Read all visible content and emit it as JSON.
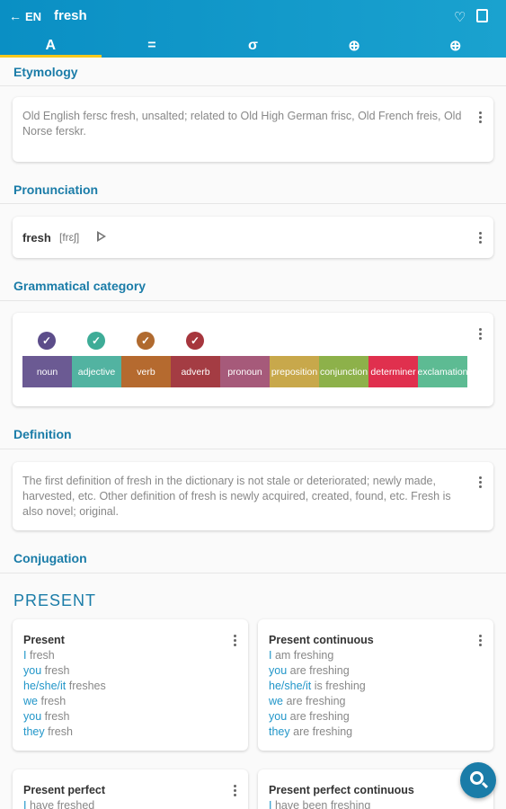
{
  "header": {
    "back_icon": "←",
    "language": "EN",
    "word": "fresh",
    "heart_icon": "♡"
  },
  "tabs": [
    {
      "label": "A",
      "icon": "letter-a-icon"
    },
    {
      "label": "=",
      "icon": "equals-icon"
    },
    {
      "label": "σ",
      "icon": "sigma-icon"
    },
    {
      "label": "⊕",
      "icon": "plus-circle-icon"
    },
    {
      "label": "⊕",
      "icon": "zoom-icon"
    }
  ],
  "sections": {
    "etymology": "Etymology",
    "pronunciation": "Pronunciation",
    "grammatical_category": "Grammatical category",
    "definition": "Definition",
    "conjugation": "Conjugation"
  },
  "etymology_text": "Old English fersc fresh, unsalted; related to Old High German frisc, Old French freis, Old Norse ferskr.",
  "pronunciation": {
    "word": "fresh",
    "ipa": "[frɛʃ]"
  },
  "categories": [
    {
      "label": "noun",
      "color": "#6b5a93",
      "checked": true,
      "check_color": "#5c4d8a"
    },
    {
      "label": "adjective",
      "color": "#52b3a1",
      "checked": true,
      "check_color": "#3eac97"
    },
    {
      "label": "verb",
      "color": "#b56a2f",
      "checked": true,
      "check_color": "#b06a2f"
    },
    {
      "label": "adverb",
      "color": "#a43c43",
      "checked": true,
      "check_color": "#a6363d"
    },
    {
      "label": "pronoun",
      "color": "#a65a7a",
      "checked": false
    },
    {
      "label": "preposition",
      "color": "#c8a84b",
      "checked": false
    },
    {
      "label": "conjunction",
      "color": "#8db14a",
      "checked": false
    },
    {
      "label": "determiner",
      "color": "#e0304e",
      "checked": false
    },
    {
      "label": "exclamation",
      "color": "#5dbb93",
      "checked": false
    }
  ],
  "definition_text": "The first definition of fresh in the dictionary is not stale or deteriorated; newly made, harvested, etc. Other definition of fresh is newly acquired, created, found, etc. Fresh is also novel; original.",
  "tense": "PRESENT",
  "conjugations": [
    {
      "title": "Present",
      "lines": [
        {
          "pron": "I",
          "verb": "fresh"
        },
        {
          "pron": "you",
          "verb": "fresh"
        },
        {
          "pron": "he/she/it",
          "verb": "freshes"
        },
        {
          "pron": "we",
          "verb": "fresh"
        },
        {
          "pron": "you",
          "verb": "fresh"
        },
        {
          "pron": "they",
          "verb": "fresh"
        }
      ]
    },
    {
      "title": "Present continuous",
      "lines": [
        {
          "pron": "I",
          "verb": "am freshing"
        },
        {
          "pron": "you",
          "verb": "are freshing"
        },
        {
          "pron": "he/she/it",
          "verb": "is freshing"
        },
        {
          "pron": "we",
          "verb": "are freshing"
        },
        {
          "pron": "you",
          "verb": "are freshing"
        },
        {
          "pron": "they",
          "verb": "are freshing"
        }
      ]
    },
    {
      "title": "Present perfect",
      "lines": [
        {
          "pron": "I",
          "verb": "have freshed"
        }
      ]
    },
    {
      "title": "Present perfect continuous",
      "lines": [
        {
          "pron": "I",
          "verb": "have been freshing"
        }
      ]
    }
  ]
}
